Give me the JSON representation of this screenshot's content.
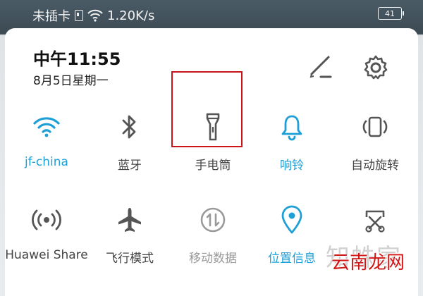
{
  "status_bar": {
    "carrier": "未插卡",
    "speed": "1.20K/s",
    "battery": "41"
  },
  "header": {
    "time": "中午11:55",
    "date": "8月5日星期一"
  },
  "tiles": [
    {
      "label": "jf-china",
      "icon": "wifi-icon",
      "state": "on"
    },
    {
      "label": "蓝牙",
      "icon": "bluetooth-icon",
      "state": "off"
    },
    {
      "label": "手电筒",
      "icon": "flashlight-icon",
      "state": "off"
    },
    {
      "label": "响铃",
      "icon": "bell-icon",
      "state": "on"
    },
    {
      "label": "自动旋转",
      "icon": "auto-rotate-icon",
      "state": "off"
    },
    {
      "label": "Huawei Share",
      "icon": "huawei-share-icon",
      "state": "off"
    },
    {
      "label": "飞行模式",
      "icon": "airplane-icon",
      "state": "off"
    },
    {
      "label": "移动数据",
      "icon": "mobile-data-icon",
      "state": "disabled"
    },
    {
      "label": "位置信息",
      "icon": "location-icon",
      "state": "on"
    },
    {
      "label": "",
      "icon": "screenshot-icon",
      "state": "off"
    }
  ],
  "watermark": {
    "background_text": "知蛛家",
    "text": "云南龙网"
  },
  "colors": {
    "accent": "#1e9fd6",
    "icon_gray": "#555555",
    "disabled_gray": "#9a9a9a",
    "highlight_red": "#c8141a"
  }
}
